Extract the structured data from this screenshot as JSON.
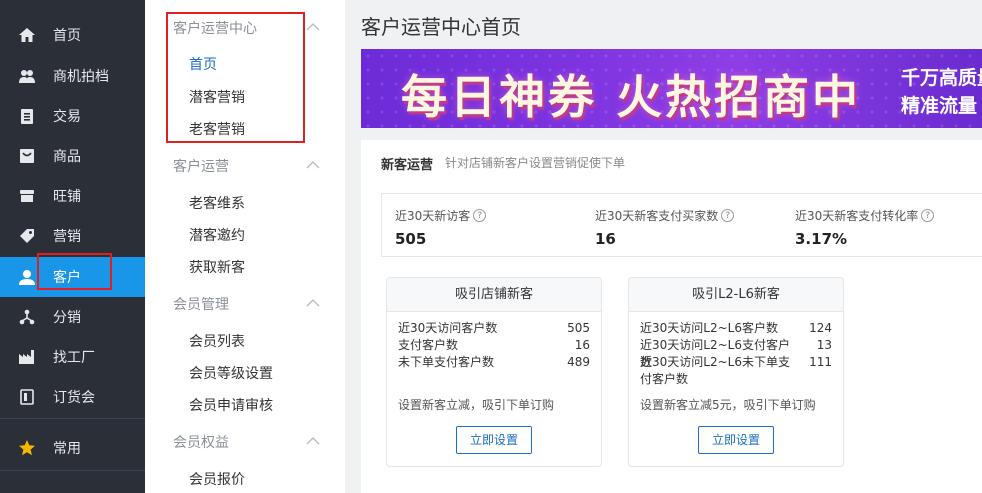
{
  "nav": {
    "items": [
      {
        "label": "首页",
        "icon": "home-icon"
      },
      {
        "label": "商机拍档",
        "icon": "partner-icon"
      },
      {
        "label": "交易",
        "icon": "clipboard-icon"
      },
      {
        "label": "商品",
        "icon": "product-icon"
      },
      {
        "label": "旺铺",
        "icon": "shop-icon"
      },
      {
        "label": "营销",
        "icon": "tag-icon"
      },
      {
        "label": "客户",
        "icon": "user-icon"
      },
      {
        "label": "分销",
        "icon": "distribution-icon"
      },
      {
        "label": "找工厂",
        "icon": "factory-icon"
      },
      {
        "label": "订货会",
        "icon": "order-fair-icon"
      },
      {
        "label": "常用",
        "icon": "star-icon"
      }
    ],
    "active": "客户",
    "active_color": "#1a96e8"
  },
  "submenu": {
    "groups": [
      {
        "title": "客户运营中心",
        "items": [
          "首页",
          "潜客营销",
          "老客营销"
        ]
      },
      {
        "title": "客户运营",
        "items": [
          "老客维系",
          "潜客邀约",
          "获取新客"
        ]
      },
      {
        "title": "会员管理",
        "items": [
          "会员列表",
          "会员等级设置",
          "会员申请审核"
        ]
      },
      {
        "title": "会员权益",
        "items": [
          "会员报价"
        ]
      }
    ],
    "active_item": "首页"
  },
  "page": {
    "title": "客户运营中心首页"
  },
  "banner": {
    "headline": "每日神券 火热招商中",
    "side_line1": "千万高质量",
    "side_line2": "精准流量 火"
  },
  "panel": {
    "title": "新客运营",
    "desc": "针对店铺新客户设置营销促使下单",
    "stats": [
      {
        "label": "近30天新访客",
        "value": "505"
      },
      {
        "label": "近30天新客支付买家数",
        "value": "16"
      },
      {
        "label": "近30天新客支付转化率",
        "value": "3.17%"
      }
    ],
    "cards": [
      {
        "title": "吸引店铺新客",
        "rows": [
          {
            "label": "近30天访问客户数",
            "value": "505"
          },
          {
            "label": "支付客户数",
            "value": "16"
          },
          {
            "label": "未下单支付客户数",
            "value": "489"
          }
        ],
        "note": "设置新客立减，吸引下单订购",
        "button": "立即设置"
      },
      {
        "title": "吸引L2-L6新客",
        "rows": [
          {
            "label": "近30天访问L2~L6客户数",
            "value": "124"
          },
          {
            "label": "近30天访问L2~L6支付客户数",
            "value": "13"
          },
          {
            "label": "近30天访问L2~L6未下单支付客户数",
            "value": "111"
          }
        ],
        "note": "设置新客立减5元，吸引下单订购",
        "button": "立即设置"
      }
    ]
  },
  "colors": {
    "highlight": "#e02020",
    "link": "#1a6ec2"
  }
}
